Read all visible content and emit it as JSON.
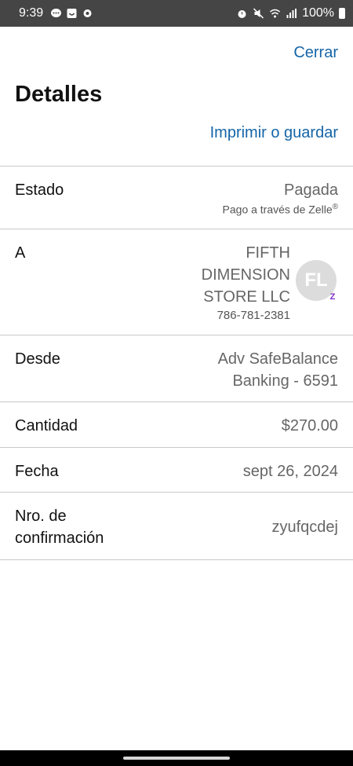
{
  "status_bar": {
    "time": "9:39",
    "battery": "100%"
  },
  "header": {
    "close_label": "Cerrar",
    "title": "Detalles",
    "print_label": "Imprimir o guardar"
  },
  "rows": {
    "estado": {
      "label": "Estado",
      "value": "Pagada",
      "sub": "Pago a través de Zelle",
      "sub_mark": "®"
    },
    "a": {
      "label": "A",
      "name_line1": "FIFTH",
      "name_line2": "DIMENSION",
      "name_line3": "STORE LLC",
      "phone": "786-781-2381",
      "avatar_initials": "FL",
      "badge": "Z"
    },
    "desde": {
      "label": "Desde",
      "value_line1": "Adv SafeBalance",
      "value_line2": "Banking - 6591"
    },
    "cantidad": {
      "label": "Cantidad",
      "value": "$270.00"
    },
    "fecha": {
      "label": "Fecha",
      "value": "sept 26, 2024"
    },
    "confirmacion": {
      "label_line1": "Nro. de",
      "label_line2": "confirmación",
      "value": "zyufqcdej"
    }
  },
  "colors": {
    "link": "#1565a8",
    "status_bar": "#454545",
    "zelle": "#7b2fc9"
  }
}
